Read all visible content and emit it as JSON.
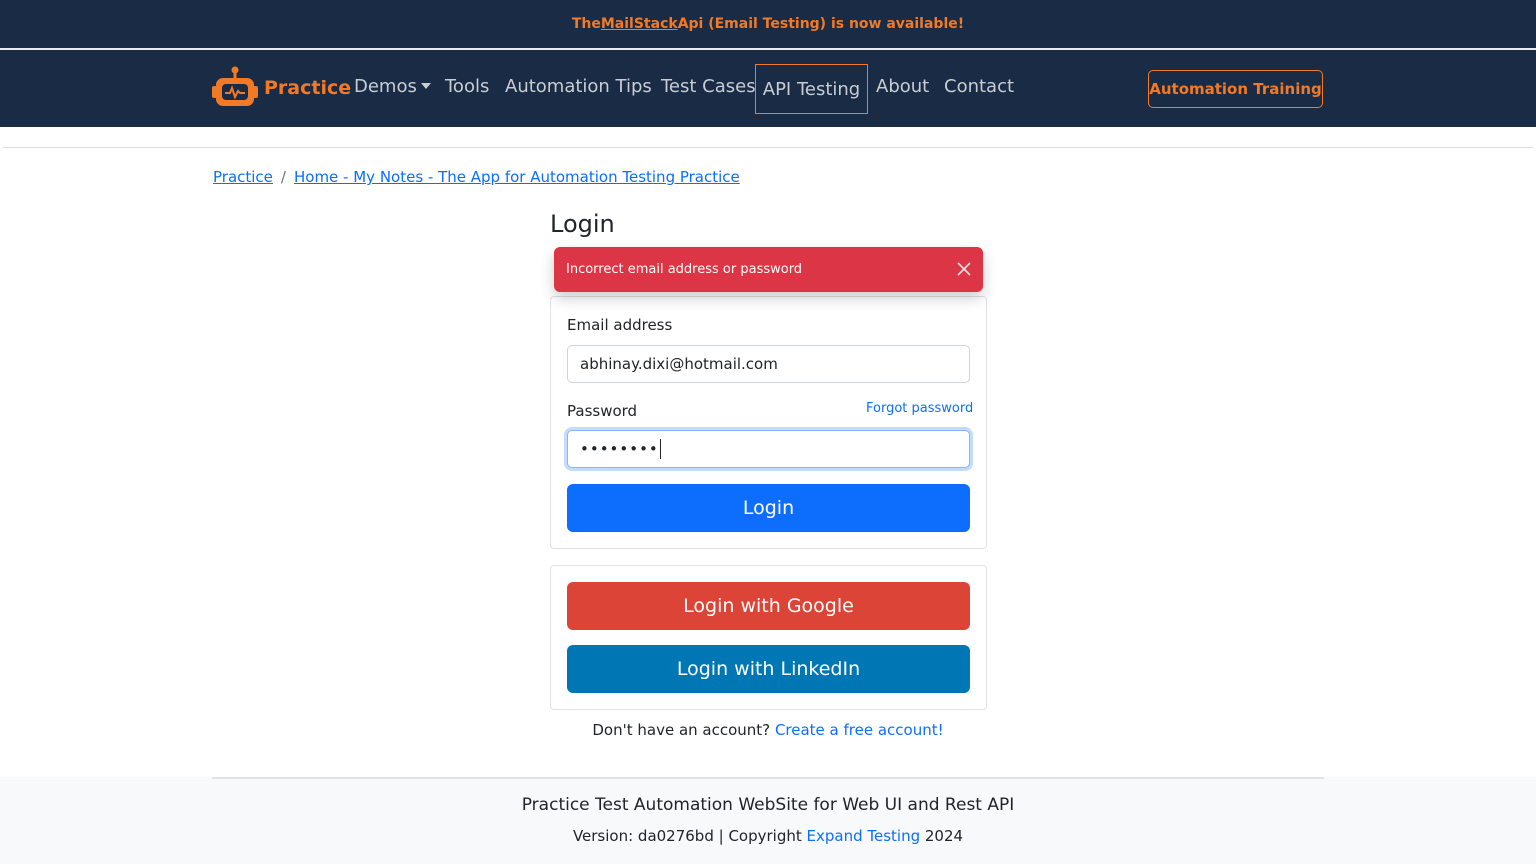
{
  "announcement": {
    "prefix": "The ",
    "link_text": "MailStack",
    "suffix": " Api (Email Testing) is now available!"
  },
  "navbar": {
    "brand": "Practice",
    "links": {
      "demos": "Demos",
      "tools": "Tools",
      "tips": "Automation Tips",
      "cases": "Test Cases",
      "api": "API Testing",
      "about": "About",
      "contact": "Contact"
    },
    "active_link": "API Testing",
    "training_button": "Automation Training"
  },
  "breadcrumb": {
    "items": [
      "Practice",
      "Home - My Notes - The App for Automation Testing Practice"
    ],
    "separator": "/"
  },
  "login": {
    "title": "Login",
    "alert": "Incorrect email address or password",
    "email_label": "Email address",
    "email_value": "abhinay.dixi@hotmail.com",
    "password_label": "Password",
    "password_value": "••••••••",
    "forgot": "Forgot password",
    "login_button": "Login",
    "google_button": "Login with Google",
    "linkedin_button": "Login with LinkedIn",
    "signup_prompt": "Don't have an account?",
    "signup_link": "Create a free account!"
  },
  "footer": {
    "title": "Practice Test Automation WebSite for Web UI and Rest API",
    "version_prefix": "Version: da0276bd | Copyright ",
    "company": "Expand Testing",
    "year": " 2024"
  },
  "colors": {
    "navy": "#1a2b45",
    "accent": "#f27a26",
    "primary": "#0d6efd",
    "danger": "#dc3545",
    "google": "#db4437",
    "linkedin": "#0077b5"
  }
}
